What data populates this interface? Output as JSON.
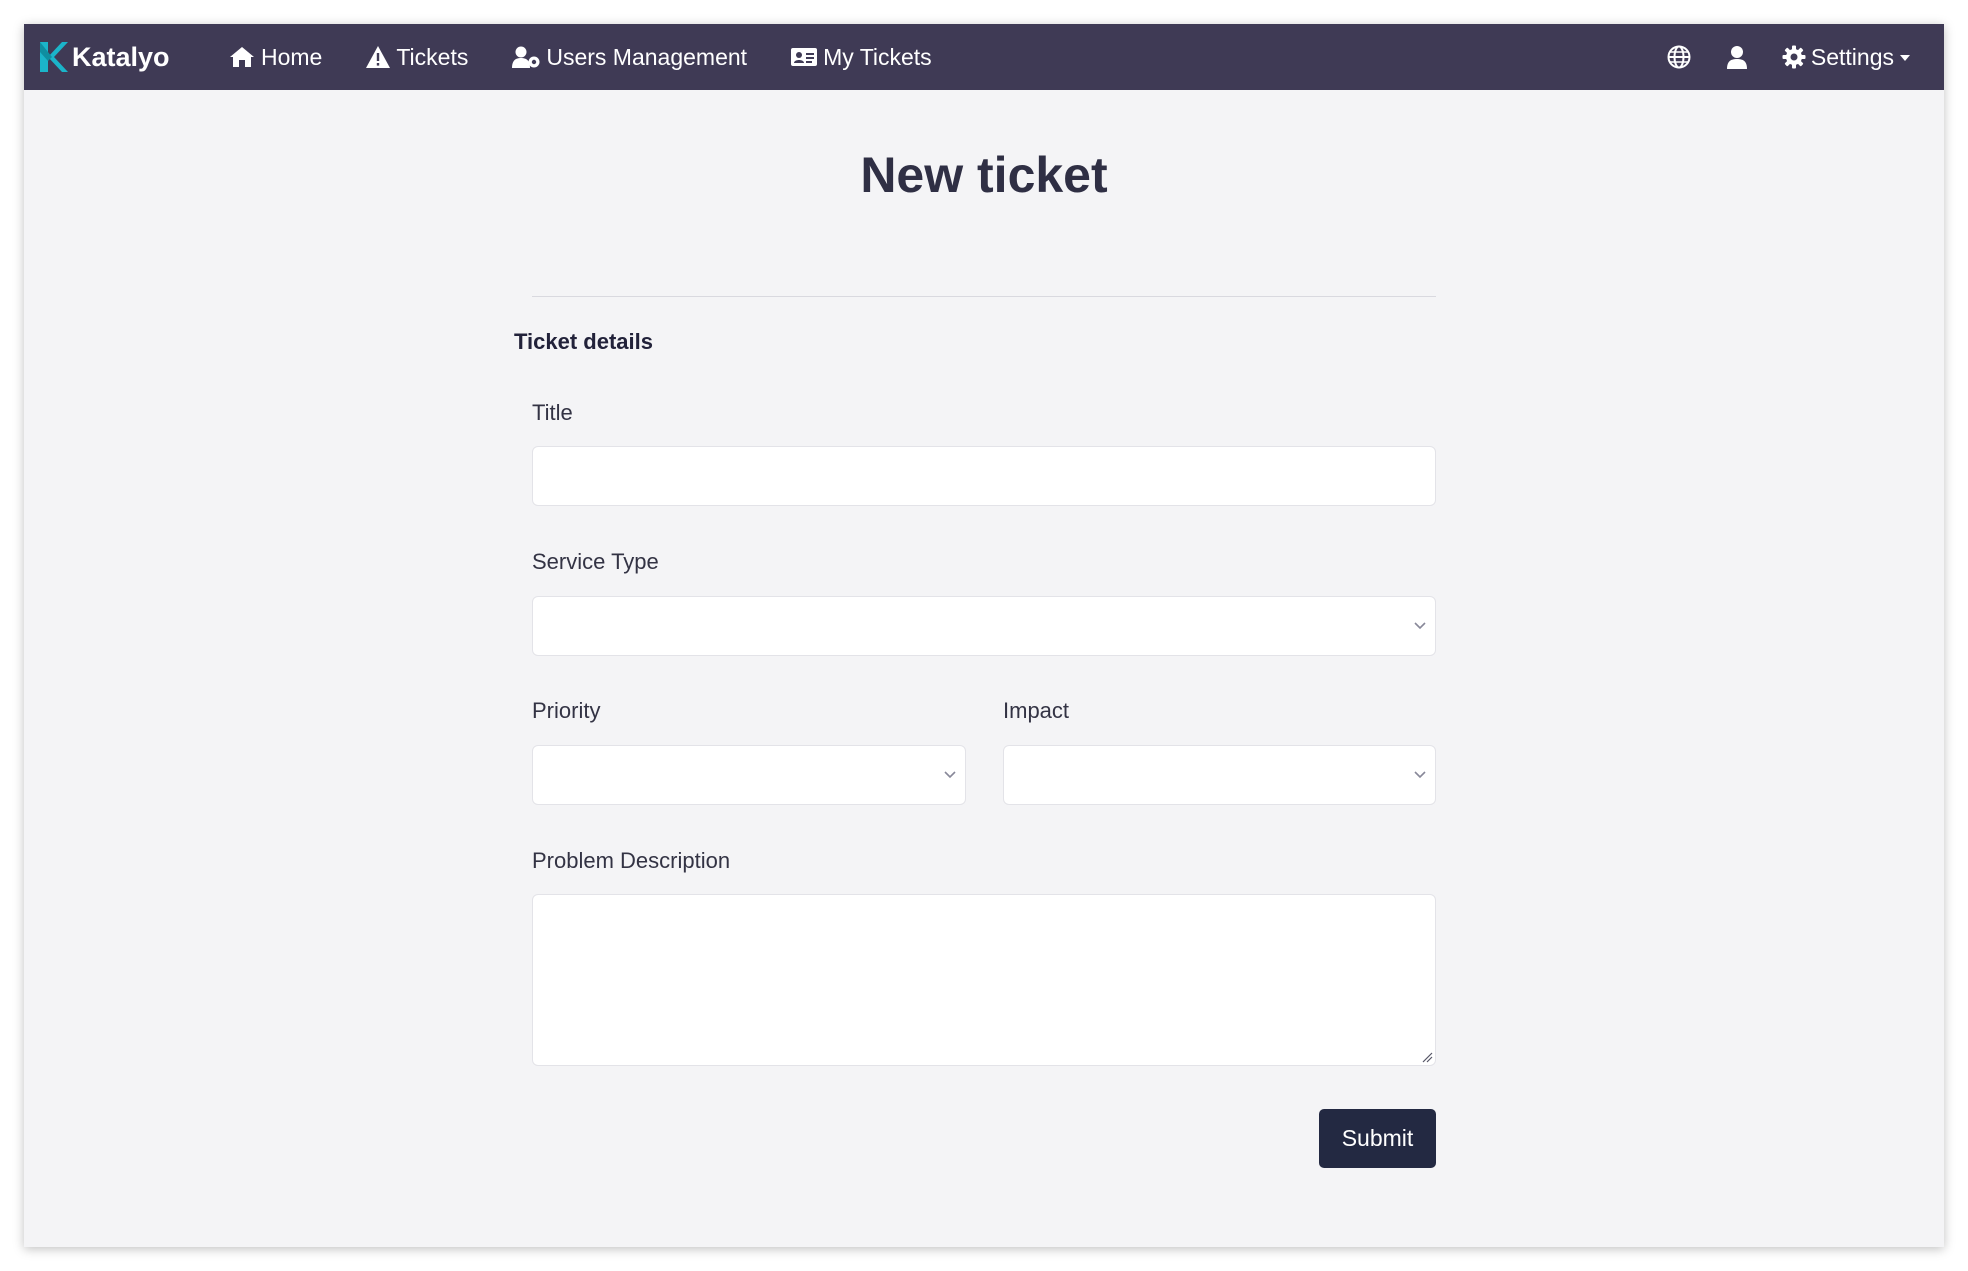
{
  "navbar": {
    "brand": "Katalyo",
    "items": [
      {
        "label": "Home",
        "icon": "home-icon"
      },
      {
        "label": "Tickets",
        "icon": "warning-icon"
      },
      {
        "label": "Users Management",
        "icon": "users-cog-icon"
      },
      {
        "label": "My Tickets",
        "icon": "id-card-icon"
      }
    ],
    "settings_label": "Settings"
  },
  "page": {
    "title": "New ticket",
    "section_title": "Ticket details"
  },
  "form": {
    "title": {
      "label": "Title",
      "value": ""
    },
    "service_type": {
      "label": "Service Type",
      "value": ""
    },
    "priority": {
      "label": "Priority",
      "value": ""
    },
    "impact": {
      "label": "Impact",
      "value": ""
    },
    "problem_description": {
      "label": "Problem Description",
      "value": ""
    },
    "submit_label": "Submit"
  },
  "colors": {
    "navbar": "#3f3a55",
    "background": "#f4f4f6",
    "submit": "#232942",
    "brand_accent": "#1bb4c9"
  }
}
